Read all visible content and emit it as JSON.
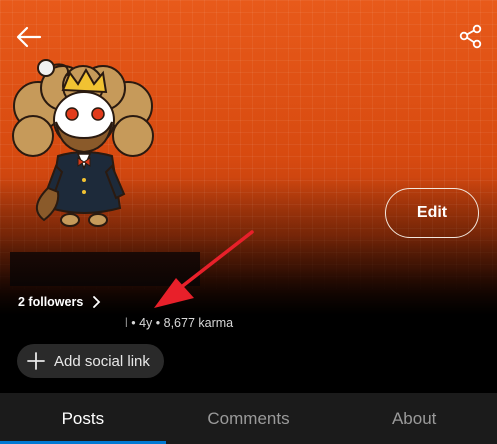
{
  "header": {
    "back_icon": "arrow-left-icon",
    "share_icon": "share-icon",
    "avatar_icon": "snoo-avatar-icon",
    "edit_label": "Edit"
  },
  "profile": {
    "followers_label": "2 followers",
    "followers_icon": "chevron-right-icon",
    "meta_prefix": "l",
    "meta_rest": " • 4y • 8,677 karma",
    "add_social_label": "Add social link",
    "add_icon": "plus-icon",
    "annotation_icon": "red-arrow-icon"
  },
  "tabs": [
    {
      "label": "Posts",
      "active": true
    },
    {
      "label": "Comments",
      "active": false
    },
    {
      "label": "About",
      "active": false
    }
  ],
  "colors": {
    "banner": "#d74a10",
    "tab_indicator": "#0079d3",
    "annotation_arrow": "#e8202a"
  }
}
